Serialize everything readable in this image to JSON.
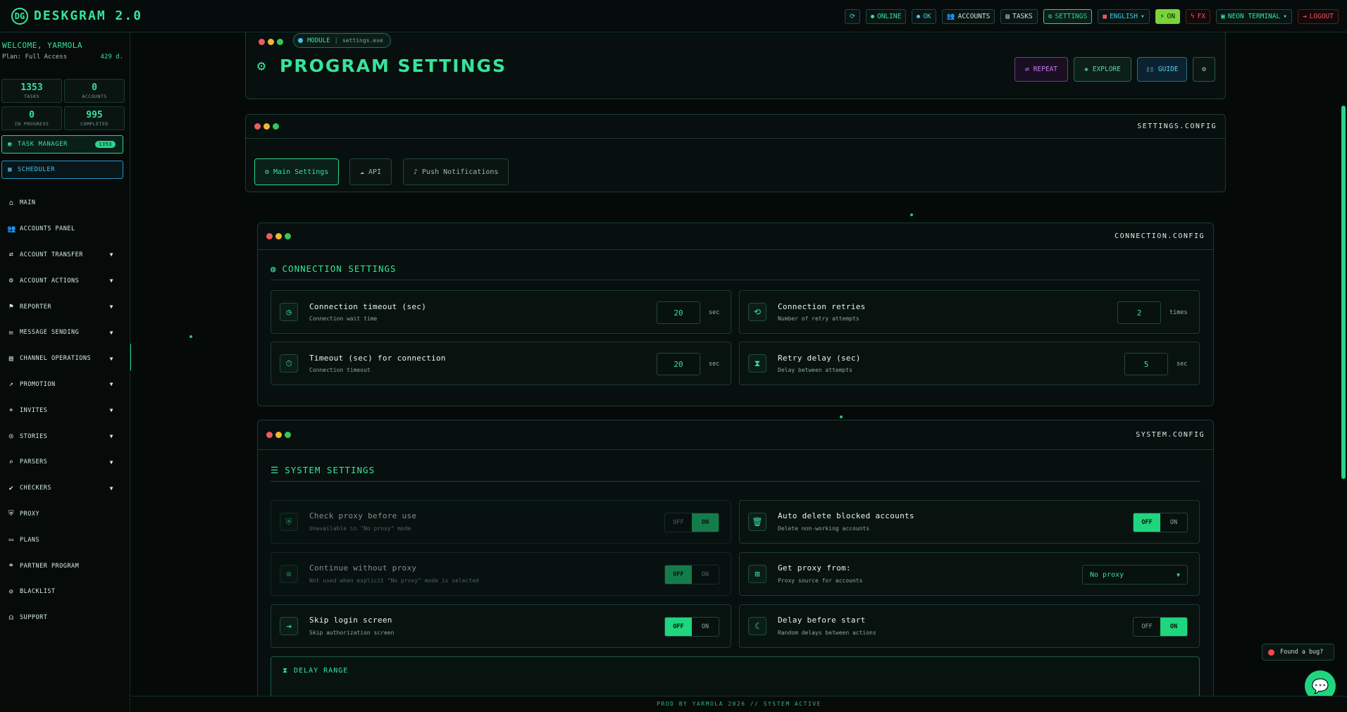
{
  "app": {
    "title": "DESKGRAM 2.0",
    "logo_glyph": "DG"
  },
  "topbar": {
    "refresh_icon": "refresh-icon",
    "online": "ONLINE",
    "ok": "OK",
    "accounts": "ACCOUNTS",
    "tasks": "TASKS",
    "settings": "SETTINGS",
    "language": "ENGLISH",
    "on": "ON",
    "fx": "FX",
    "theme": "NEON TERMINAL",
    "logout": "LOGOUT"
  },
  "sidebar": {
    "welcome": "WELCOME, YARMOLA",
    "plan": "Plan: Full Access",
    "days": "429 d.",
    "stats": [
      {
        "value": "1353",
        "label": "TASKS"
      },
      {
        "value": "0",
        "label": "ACCOUNTS"
      },
      {
        "value": "0",
        "label": "IN PROGRESS"
      },
      {
        "value": "995",
        "label": "COMPLETED"
      }
    ],
    "task_manager": "TASK MANAGER",
    "task_badge": "1353",
    "scheduler": "SCHEDULER",
    "items": [
      {
        "label": "MAIN",
        "icon": "home-icon",
        "chev": false
      },
      {
        "label": "ACCOUNTS PANEL",
        "icon": "users-icon",
        "chev": false
      },
      {
        "label": "ACCOUNT TRANSFER",
        "icon": "user-transfer-icon",
        "chev": true
      },
      {
        "label": "ACCOUNT ACTIONS",
        "icon": "user-gear-icon",
        "chev": true
      },
      {
        "label": "REPORTER",
        "icon": "flag-icon",
        "chev": true
      },
      {
        "label": "MESSAGE SENDING",
        "icon": "message-icon",
        "chev": true
      },
      {
        "label": "CHANNEL OPERATIONS",
        "icon": "channel-icon",
        "chev": true
      },
      {
        "label": "PROMOTION",
        "icon": "chart-line-icon",
        "chev": true
      },
      {
        "label": "INVITES",
        "icon": "user-plus-icon",
        "chev": true
      },
      {
        "label": "STORIES",
        "icon": "stories-icon",
        "chev": true
      },
      {
        "label": "PARSERS",
        "icon": "search-icon",
        "chev": true
      },
      {
        "label": "CHECKERS",
        "icon": "check-circle-icon",
        "chev": true
      },
      {
        "label": "PROXY",
        "icon": "shield-icon",
        "chev": false
      },
      {
        "label": "PLANS",
        "icon": "card-icon",
        "chev": false
      },
      {
        "label": "PARTNER PROGRAM",
        "icon": "partner-icon",
        "chev": false
      },
      {
        "label": "BLACKLIST",
        "icon": "user-block-icon",
        "chev": false
      },
      {
        "label": "SUPPORT",
        "icon": "headset-icon",
        "chev": false
      }
    ]
  },
  "header": {
    "module_label": "MODULE",
    "module_file": "settings.exe",
    "title": "PROGRAM SETTINGS",
    "buttons": {
      "repeat": "REPEAT",
      "explore": "EXPLORE",
      "guide": "GUIDE"
    }
  },
  "settings_config": {
    "title": "SETTINGS.CONFIG",
    "tabs": [
      "Main Settings",
      "API",
      "Push Notifications"
    ]
  },
  "connection": {
    "config_title": "CONNECTION.CONFIG",
    "section_title": "CONNECTION SETTINGS",
    "fields": [
      {
        "label": "Connection timeout (sec)",
        "sub": "Connection wait time",
        "value": "20",
        "unit": "sec"
      },
      {
        "label": "Connection retries",
        "sub": "Number of retry attempts",
        "value": "2",
        "unit": "times"
      },
      {
        "label": "Timeout (sec) for connection",
        "sub": "Connection timeout",
        "value": "20",
        "unit": "sec"
      },
      {
        "label": "Retry delay (sec)",
        "sub": "Delay between attempts",
        "value": "5",
        "unit": "sec"
      }
    ]
  },
  "system": {
    "config_title": "SYSTEM.CONFIG",
    "section_title": "SYSTEM SETTINGS",
    "off": "OFF",
    "on": "ON",
    "fields": [
      {
        "label": "Check proxy before use",
        "sub": "Unavailable in \"No proxy\" mode",
        "state": "ON"
      },
      {
        "label": "Auto delete blocked accounts",
        "sub": "Delete non-working accounts",
        "state": "OFF"
      },
      {
        "label": "Continue without proxy",
        "sub": "Not used when explicit \"No proxy\" mode is selected",
        "state": "OFF"
      },
      {
        "label": "Get proxy from:",
        "sub": "Proxy source for accounts",
        "select": "No proxy"
      },
      {
        "label": "Skip login screen",
        "sub": "Skip authorization screen",
        "state": "OFF"
      },
      {
        "label": "Delay before start",
        "sub": "Random delays between actions",
        "state": "ON"
      }
    ],
    "delay_range": "DELAY RANGE"
  },
  "footer": {
    "text": "PROD BY YARMOLA 2026   // SYSTEM ACTIVE"
  },
  "bug": {
    "label": "Found a bug?"
  },
  "colors": {
    "accent": "#36e49a",
    "background": "#050a09",
    "cyan": "#43c7e6",
    "danger": "#ef5464"
  }
}
